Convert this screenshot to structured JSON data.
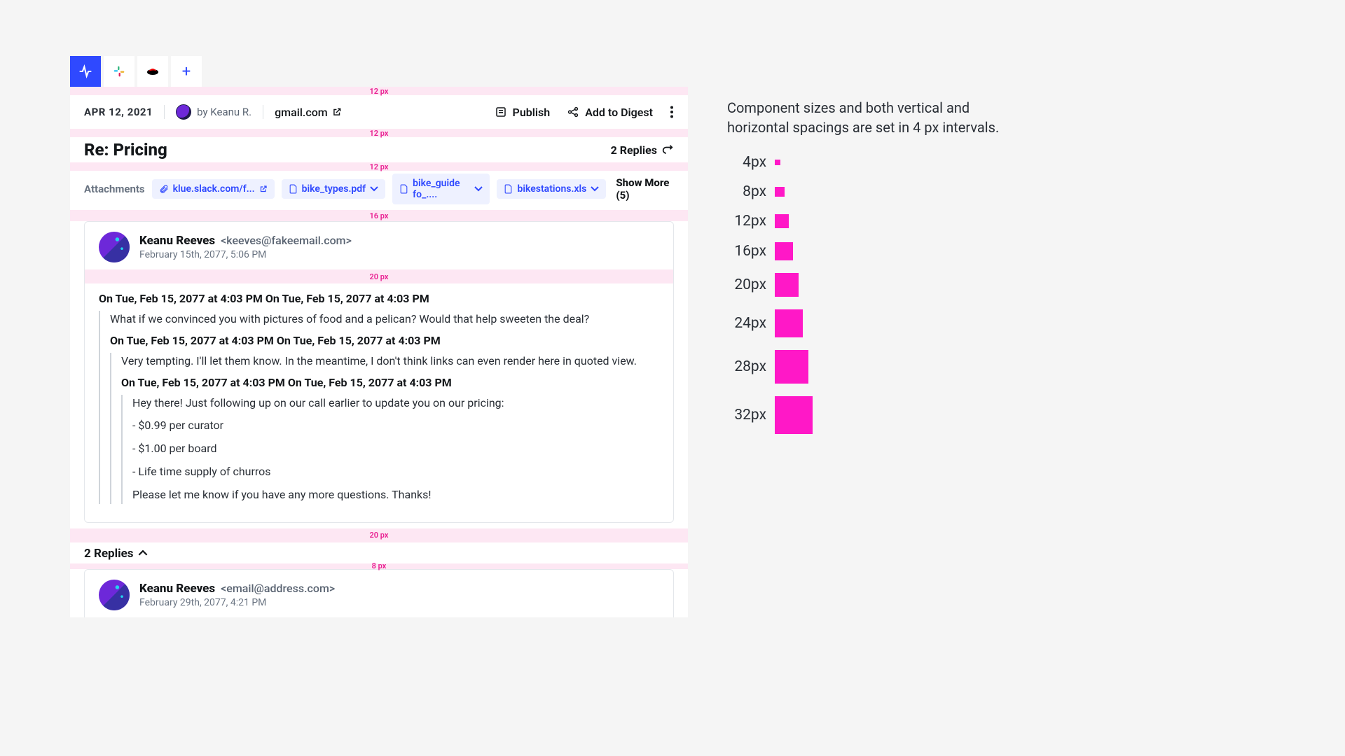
{
  "tabs": {
    "add_label": "+"
  },
  "header": {
    "date": "APR 12, 2021",
    "byline": "by Keanu R.",
    "source": "gmail.com",
    "publish": "Publish",
    "digest": "Add to Digest"
  },
  "subject": {
    "title": "Re: Pricing",
    "replies": "2 Replies"
  },
  "attachments": {
    "label": "Attachments",
    "chips": [
      "klue.slack.com/f...",
      "bike_types.pdf",
      "bike_guide fo_....",
      "bikestations.xls"
    ],
    "show_more": "Show More (5)"
  },
  "message1": {
    "name": "Keanu Reeves",
    "email": "<keeves@fakeemail.com>",
    "ts": "February 15th, 2077, 5:06 PM",
    "q1": "On Tue, Feb 15, 2077 at 4:03 PM   On Tue, Feb 15, 2077 at 4:03 PM",
    "b1": "What if we convinced you with pictures of food and a pelican? Would that help sweeten the deal?",
    "q2": "On Tue, Feb 15, 2077 at 4:03 PM   On Tue, Feb 15, 2077 at 4:03 PM",
    "b2": "Very tempting. I'll let them know. In the meantime, I don't think links can even render here in quoted view.",
    "q3": "On Tue, Feb 15, 2077 at 4:03 PM   On Tue, Feb 15, 2077 at 4:03 PM",
    "b3": "Hey there! Just following up on our call earlier to update you on our pricing:",
    "l1": "- $0.99 per curator",
    "l2": "- $1.00 per board",
    "l3": "- Life time supply of churros",
    "b4": "Please let me know if you have any more questions. Thanks!"
  },
  "message2": {
    "name": "Keanu Reeves",
    "email": "<email@address.com>",
    "ts": "February 29th, 2077, 4:21 PM"
  },
  "replies_toggle": "2 Replies",
  "spacers": {
    "s12": "12 px",
    "s16": "16 px",
    "s20": "20 px",
    "s8": "8 px"
  },
  "right": {
    "desc": "Component sizes and both vertical and horizontal spacings are set in 4 px intervals.",
    "scale": [
      {
        "label": "4px",
        "size": 8
      },
      {
        "label": "8px",
        "size": 14
      },
      {
        "label": "12px",
        "size": 20
      },
      {
        "label": "16px",
        "size": 26
      },
      {
        "label": "20px",
        "size": 34
      },
      {
        "label": "24px",
        "size": 40
      },
      {
        "label": "28px",
        "size": 48
      },
      {
        "label": "32px",
        "size": 54
      }
    ]
  }
}
